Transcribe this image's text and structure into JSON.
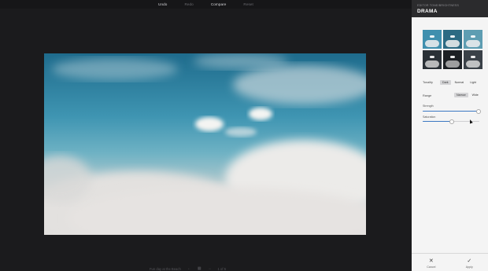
{
  "toolbar": {
    "undo_label": "Undo",
    "redo_label": "Redo",
    "compare_label": "Compare",
    "reset_label": "Reset"
  },
  "bottom_nav": {
    "photo_label": "Fun day at the Beach",
    "page_indicator": "1 of 5",
    "prev_icon": "arrow-left-icon",
    "grid_icon": "grid-icon",
    "next_icon": "arrow-right-icon"
  },
  "panel": {
    "subtitle": "EDITOR TONE/BRIGHTNESS",
    "title": "DRAMA",
    "presets": [
      {
        "bg": "#3f8fae"
      },
      {
        "bg": "#2c6a83"
      },
      {
        "bg": "#5e9db2"
      },
      {
        "bg": "#2a3036"
      },
      {
        "bg": "#1c2024"
      },
      {
        "bg": "#3a4148"
      }
    ],
    "tonality": {
      "label": "Tonality",
      "options": [
        "Dark",
        "Normal",
        "Light"
      ],
      "selected": "Dark"
    },
    "range": {
      "label": "Range",
      "options": [
        "Narrow",
        "Wide"
      ],
      "selected": "Narrow"
    },
    "strength": {
      "label": "Strength",
      "value": 0.97
    },
    "saturation": {
      "label": "Saturation",
      "value": 0.5
    },
    "cancel_label": "Cancel",
    "apply_label": "Apply",
    "cancel_icon": "close-icon",
    "apply_icon": "check-icon"
  },
  "colors": {
    "accent": "#3a78c2",
    "panel_bg": "#f4f4f4",
    "header_bg": "#2b2b2d",
    "app_bg": "#1b1b1d"
  }
}
